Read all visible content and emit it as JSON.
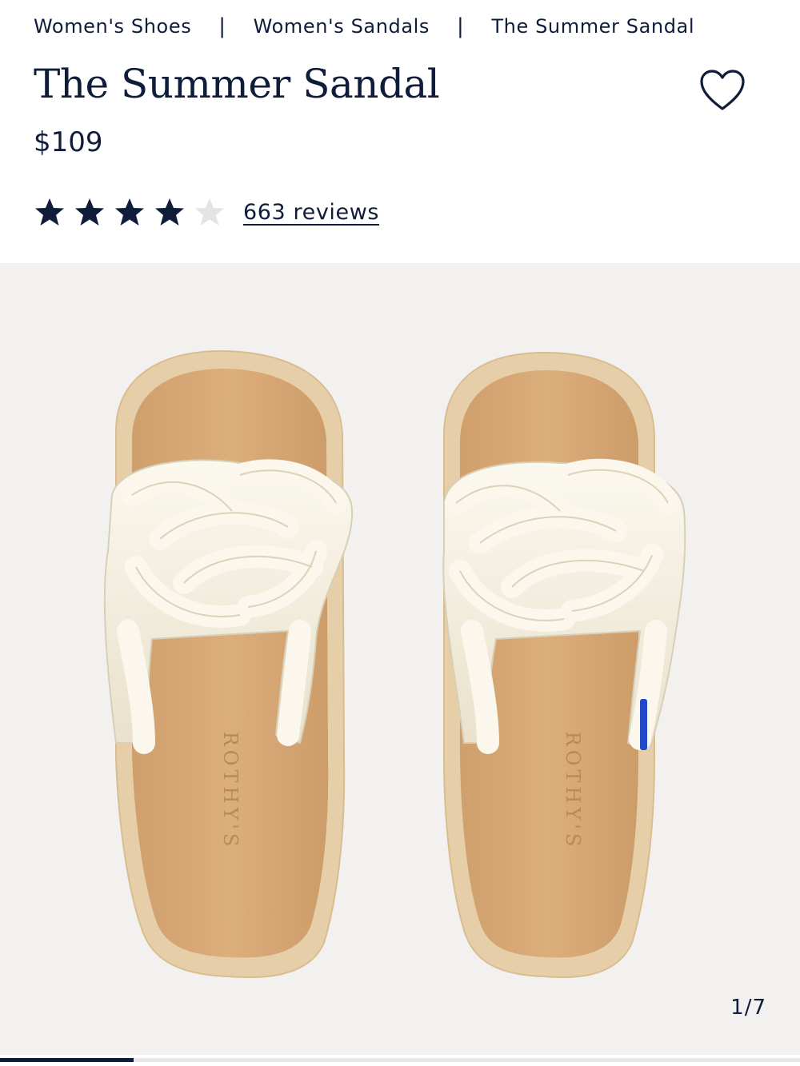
{
  "breadcrumb": [
    {
      "label": "Women's Shoes"
    },
    {
      "label": "Women's Sandals"
    },
    {
      "label": "The Summer Sandal"
    }
  ],
  "breadcrumb_separator": "|",
  "product": {
    "title": "The Summer Sandal",
    "price": "$109",
    "rating": 4,
    "rating_max": 5,
    "reviews_label": "663 reviews"
  },
  "gallery": {
    "counter": "1/7",
    "current_index": 1,
    "total": 7,
    "progress_fraction": 0.1667,
    "sole_brand_text": "ROTHY'S"
  },
  "icons": {
    "wishlist": "heart-outline-icon",
    "star_filled": "star-filled-icon",
    "star_empty": "star-empty-icon"
  },
  "colors": {
    "navy": "#0f1d3a",
    "image_background": "#f2f1ef",
    "footbed": "#d6a875",
    "sole_edge": "#e6cfa8",
    "strap": "#f4efe1",
    "empty_star": "#e4e4e4"
  }
}
